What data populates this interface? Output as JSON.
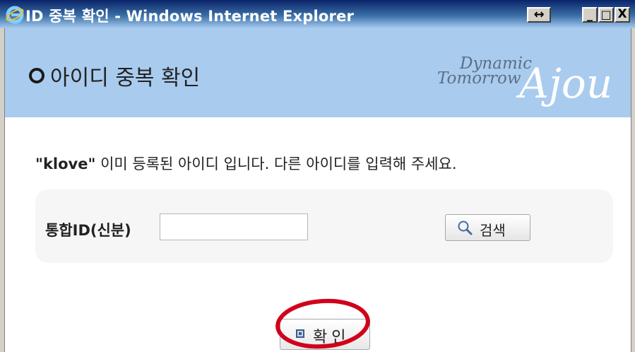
{
  "window": {
    "title": "ID 중복 확인 - Windows Internet Explorer",
    "resize_glyph": "↔",
    "min_glyph": "_",
    "max_glyph": "□",
    "close_glyph": "X"
  },
  "header": {
    "title": "아이디 중복 확인",
    "logo_line1": "Dynamic",
    "logo_line2": "Tomorrow",
    "logo_script": "Ajou"
  },
  "message": {
    "user_id": "\"klove\"",
    "text": " 이미 등록된 아이디 입니다. 다른 아이디를 입력해 주세요."
  },
  "search": {
    "label": "통합ID(신분)",
    "input_value": "",
    "button_label": "검색"
  },
  "confirm": {
    "button_label": "확인"
  },
  "colors": {
    "header_bg": "#a9cbee",
    "highlight": "#d0021b"
  }
}
